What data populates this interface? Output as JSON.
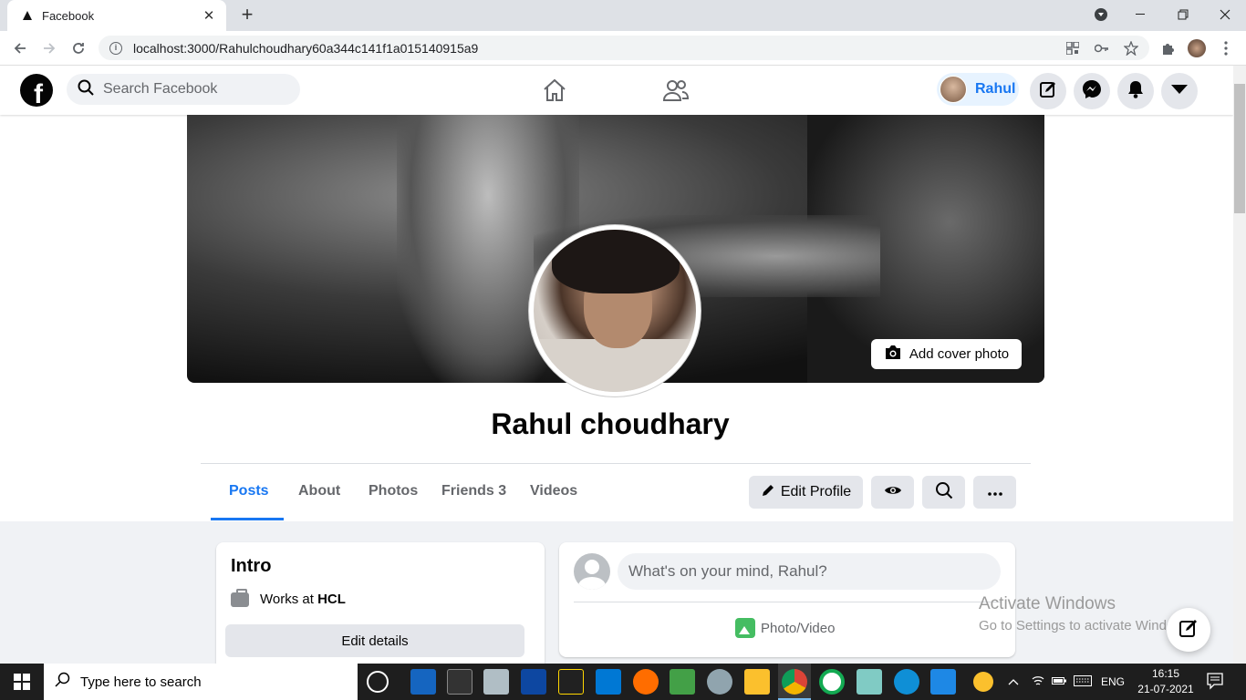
{
  "browser": {
    "tab_title": "Facebook",
    "tab_close": "✕",
    "new_tab": "+",
    "url": "localhost:3000/Rahulchoudhary60a344c141f1a015140915a9"
  },
  "fb_header": {
    "logo": "f",
    "search_placeholder": "Search Facebook",
    "user_name": "Rahul",
    "icons": [
      "home-icon",
      "friends-icon",
      "edit-icon",
      "messenger-icon",
      "bell-icon",
      "caret-down-icon"
    ]
  },
  "cover": {
    "add_cover_label": "Add cover photo"
  },
  "profile": {
    "name": "Rahul choudhary"
  },
  "tabs": [
    {
      "label": "Posts",
      "active": true
    },
    {
      "label": "About"
    },
    {
      "label": "Photos"
    },
    {
      "label": "Friends 3"
    },
    {
      "label": "Videos"
    }
  ],
  "actions": {
    "edit_profile": "Edit Profile"
  },
  "intro": {
    "title": "Intro",
    "works_prefix": "Works at ",
    "works_company": "HCL",
    "edit_details": "Edit details"
  },
  "composer": {
    "placeholder": "What's on your mind, Rahul?",
    "photo_video": "Photo/Video"
  },
  "watermark": {
    "line1": "Activate Windows",
    "line2": "Go to Settings to activate Windows."
  },
  "taskbar": {
    "search_placeholder": "Type here to search",
    "lang": "ENG",
    "time": "16:15",
    "date": "21-07-2021"
  },
  "colors": {
    "accent": "#1877f2",
    "bg_grey": "#f0f2f5",
    "button_grey": "#e4e6eb"
  }
}
